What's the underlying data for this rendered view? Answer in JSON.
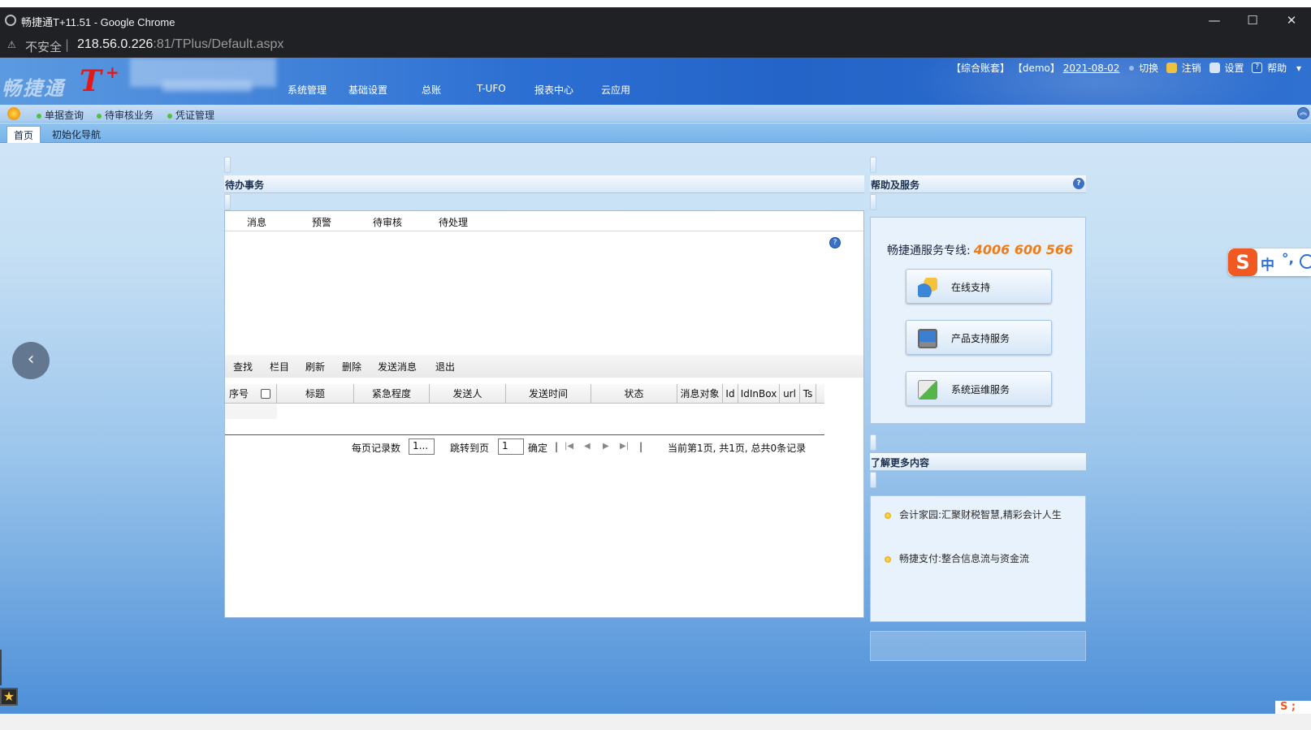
{
  "browser": {
    "title": "畅捷通T+11.51 - Google Chrome",
    "insecure_label": "不安全",
    "separator": "|",
    "url_host": "218.56.0.226",
    "url_rest": ":81/TPlus/Default.aspx",
    "warn_icon": "⚠",
    "minimize": "—",
    "maximize": "☐",
    "close": "✕"
  },
  "header": {
    "logo_text": "畅捷通",
    "logo_brand": "T",
    "logo_plus": "+",
    "nav": [
      "系统管理",
      "基础设置",
      "总账",
      "T-UFO",
      "报表中心",
      "云应用"
    ],
    "account": "【综合账套】",
    "user": "【demo】",
    "date": "2021-08-02",
    "switch_label": "切换",
    "logout_label": "注销",
    "settings_label": "设置",
    "help_label": "帮助",
    "help_glyph": "?",
    "dropdown": "▾"
  },
  "subbar": {
    "items": [
      "单据查询",
      "待审核业务",
      "凭证管理"
    ],
    "collapse_glyph": "︽"
  },
  "tabs": [
    "首页",
    "初始化导航"
  ],
  "todo": {
    "title": "待办事务",
    "tabs": [
      "消息",
      "预警",
      "待审核",
      "待处理"
    ],
    "help_glyph": "?",
    "toolbar": [
      "查找",
      "栏目",
      "刷新",
      "删除",
      "发送消息",
      "退出"
    ],
    "columns": [
      "序号",
      "标题",
      "紧急程度",
      "发送人",
      "发送时间",
      "状态",
      "消息对象",
      "Id",
      "IdInBox",
      "url",
      "Ts"
    ],
    "pager": {
      "per_page_label": "每页记录数",
      "per_page_value": "1...",
      "goto_label": "跳转到页",
      "goto_value": "1",
      "confirm_label": "确定",
      "status": "当前第1页, 共1页, 总共0条记录",
      "first_glyph": "|◀",
      "prev_glyph": "◀",
      "next_glyph": "▶",
      "last_glyph": "▶|",
      "bar_glyph": "|"
    }
  },
  "help_panel": {
    "title": "帮助及服务",
    "help_glyph": "?",
    "hotline_label": "畅捷通服务专线:",
    "hotline_number": "4006 600 566",
    "services": [
      "在线支持",
      "产品支持服务",
      "系统运维服务"
    ]
  },
  "more_panel": {
    "title": "了解更多内容",
    "items": [
      "会计家园:汇聚财税智慧,精彩会计人生",
      "畅捷支付:整合信息流与资金流"
    ]
  },
  "ime": {
    "logo": "S",
    "lang": "中",
    "punct": "°,"
  },
  "widgets": {
    "back_glyph": "‹",
    "star_glyph": "★",
    "mini_s": "S ;"
  }
}
